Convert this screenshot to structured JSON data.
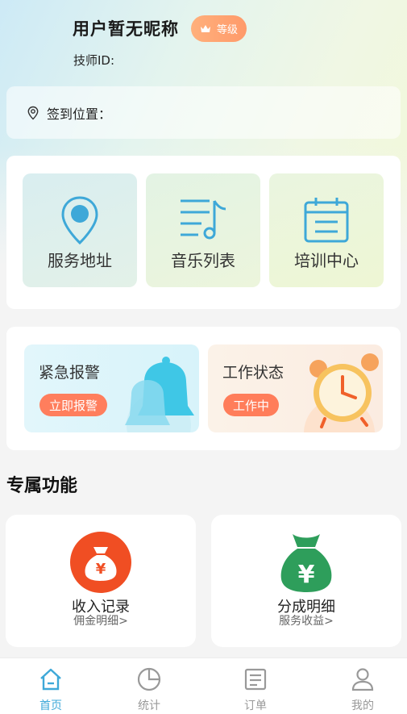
{
  "profile": {
    "nickname": "用户暂无昵称",
    "level_label": "等级",
    "tech_id_label": "技师ID:"
  },
  "checkin": {
    "label": "签到位置："
  },
  "quick_links": [
    {
      "label": "服务地址",
      "icon": "location-pin-icon"
    },
    {
      "label": "音乐列表",
      "icon": "music-list-icon"
    },
    {
      "label": "培训中心",
      "icon": "calendar-icon"
    }
  ],
  "actions": {
    "alarm": {
      "title": "紧急报警",
      "button": "立即报警"
    },
    "status": {
      "title": "工作状态",
      "button": "工作中"
    }
  },
  "section": {
    "title": "专属功能"
  },
  "features": [
    {
      "title": "收入记录",
      "subtitle": "佣金明细>",
      "icon": "money-bag-icon",
      "color": "#f04e23"
    },
    {
      "title": "分成明细",
      "subtitle": "服务收益>",
      "icon": "yuan-bag-icon",
      "color": "#2e9e5b"
    }
  ],
  "tabs": [
    {
      "label": "首页",
      "active": true
    },
    {
      "label": "统计",
      "active": false
    },
    {
      "label": "订单",
      "active": false
    },
    {
      "label": "我的",
      "active": false
    }
  ],
  "colors": {
    "accent": "#3ea8d8",
    "badge": "#ff9a6a",
    "alert_button": "#ff7d5a"
  }
}
